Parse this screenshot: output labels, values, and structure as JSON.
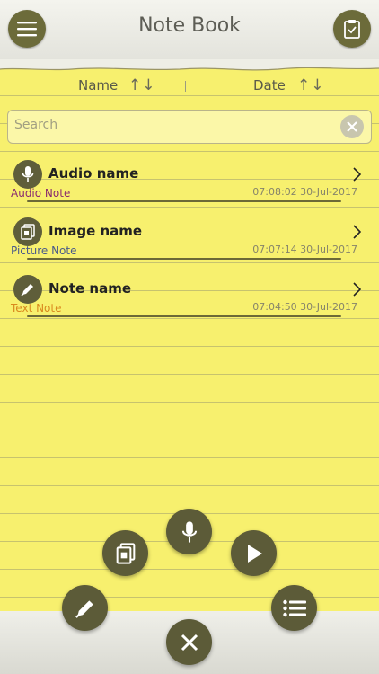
{
  "header": {
    "title": "Note Book",
    "menu_icon": "menu-icon",
    "clipboard_icon": "clipboard-check-icon"
  },
  "sortbar": {
    "name_label": "Name",
    "date_label": "Date",
    "arrows": "↑↓"
  },
  "search": {
    "placeholder": "Search",
    "value": ""
  },
  "notes": [
    {
      "name": "Audio name",
      "type": "Audio Note",
      "timestamp": "07:08:02 30-Jul-2017",
      "icon": "microphone-icon",
      "type_color": "#8a2a6e"
    },
    {
      "name": "Image name",
      "type": "Picture Note",
      "timestamp": "07:07:14 30-Jul-2017",
      "icon": "picture-icon",
      "type_color": "#4a5a8a"
    },
    {
      "name": "Note name",
      "type": "Text Note",
      "timestamp": "07:04:50 30-Jul-2017",
      "icon": "pencil-icon",
      "type_color": "#d98a1e"
    }
  ],
  "fab_menu": [
    "pencil-icon",
    "picture-icon",
    "microphone-icon",
    "play-icon",
    "list-icon",
    "close-icon"
  ],
  "colors": {
    "paper": "#f7f06e",
    "button": "#5c5b38"
  }
}
